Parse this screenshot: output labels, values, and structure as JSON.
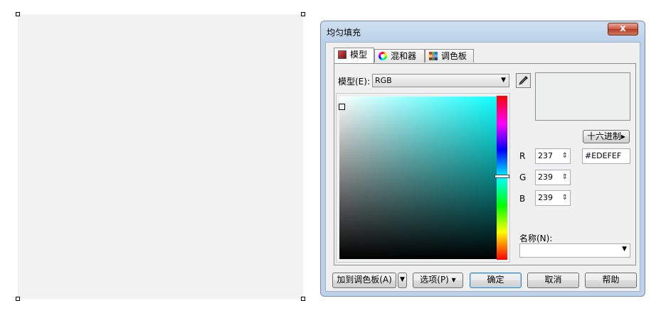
{
  "dialog": {
    "title": "均匀填充",
    "close_label": "x",
    "tabs": [
      {
        "label": "模型",
        "icon": "color-model-icon",
        "active": true
      },
      {
        "label": "混和器",
        "icon": "color-mixer-icon",
        "active": false
      },
      {
        "label": "调色板",
        "icon": "color-palette-icon",
        "active": false
      }
    ],
    "model_label": "模型(E):",
    "model_value": "RGB",
    "hex_mode_button": "十六进制▸",
    "channels": [
      {
        "label": "R",
        "value": "237"
      },
      {
        "label": "G",
        "value": "239"
      },
      {
        "label": "B",
        "value": "239"
      }
    ],
    "hex_value": "#EDEFEF",
    "name_label": "名称(N):",
    "name_value": "",
    "current_color": "#EDEFEF",
    "hue_color": "#00FFFF",
    "buttons": {
      "add_to_palette": "加到调色板(A)",
      "options": "选项(P) ▾",
      "ok": "确定",
      "cancel": "取消",
      "help": "帮助"
    }
  },
  "canvas": {
    "object_fill": "#F2F2F2"
  }
}
